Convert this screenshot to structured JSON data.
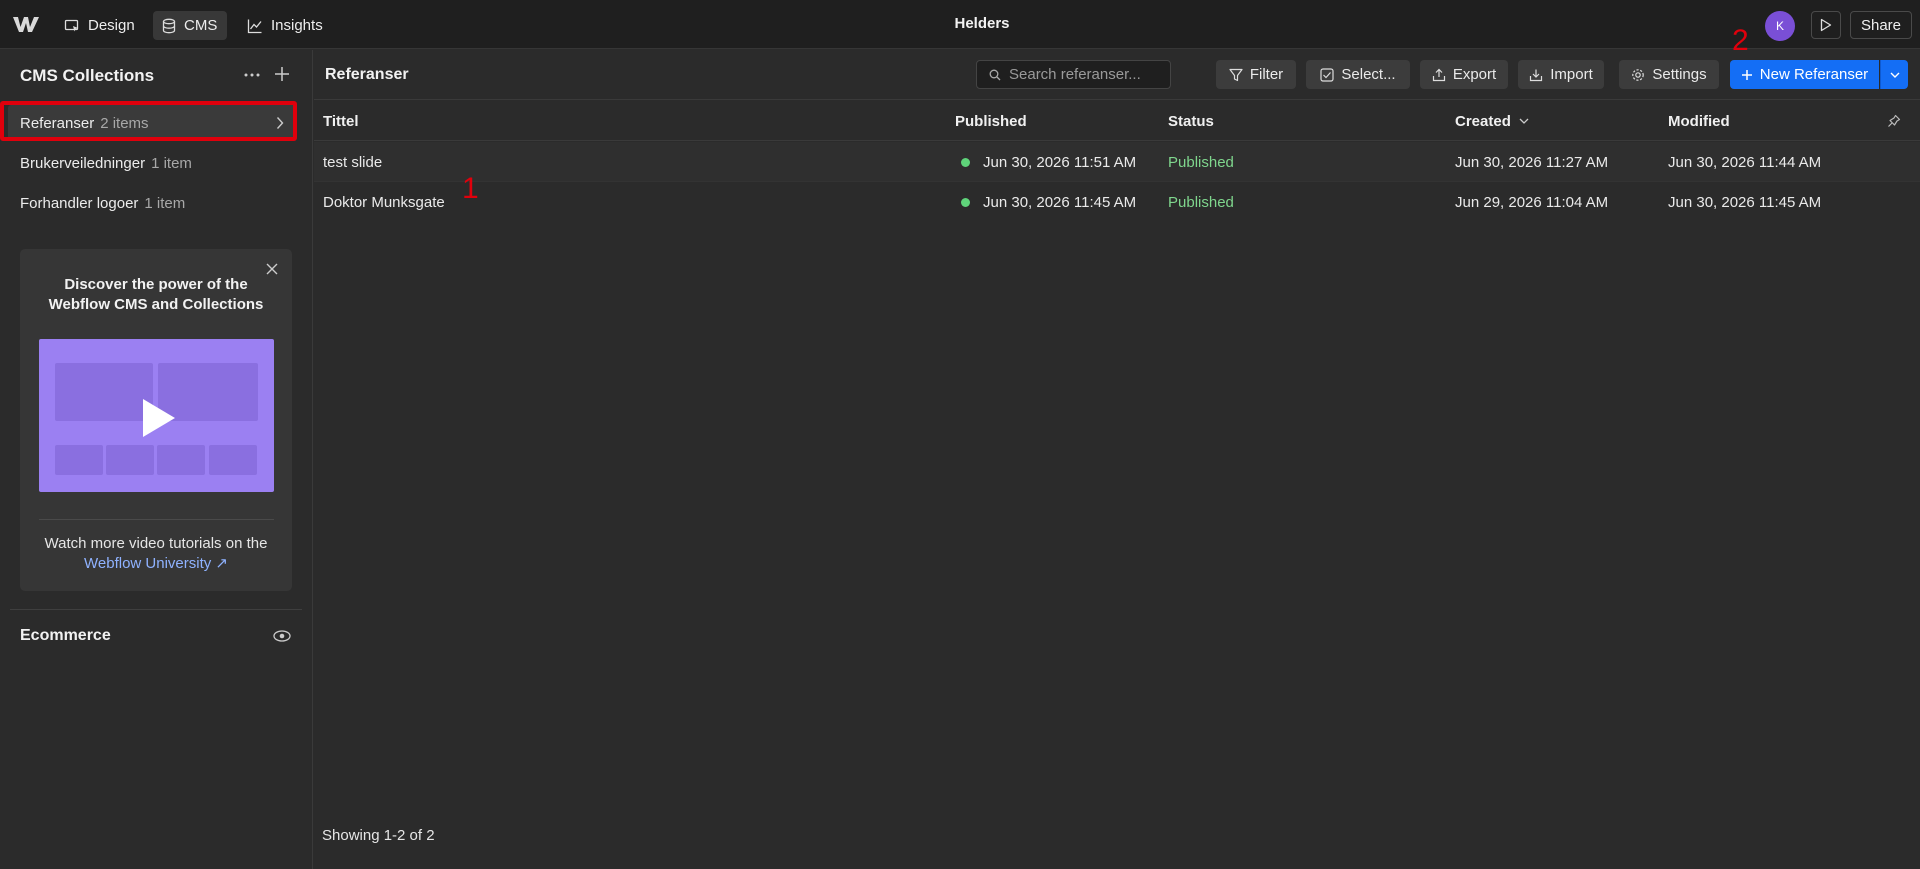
{
  "topbar": {
    "tabs": [
      {
        "label": "Design",
        "icon": "design-cursor-icon"
      },
      {
        "label": "CMS",
        "icon": "database-icon"
      },
      {
        "label": "Insights",
        "icon": "chart-line-icon"
      }
    ],
    "site_title": "Helders",
    "avatar_initial": "K",
    "share_label": "Share"
  },
  "sidebar": {
    "title": "CMS Collections",
    "collections": [
      {
        "name": "Referanser",
        "count": "2 items"
      },
      {
        "name": "Brukerveiledninger",
        "count": "1 item"
      },
      {
        "name": "Forhandler logoer",
        "count": "1 item"
      }
    ],
    "promo": {
      "title": "Discover the power of the Webflow CMS and Collections",
      "text": "Watch more video tutorials on the",
      "link": "Webflow University ↗"
    },
    "ecommerce_label": "Ecommerce"
  },
  "main": {
    "title": "Referanser",
    "search_placeholder": "Search referanser...",
    "toolbar": {
      "filter": "Filter",
      "select": "Select...",
      "export": "Export",
      "import": "Import",
      "settings": "Settings",
      "new": "New Referanser"
    },
    "columns": {
      "title": "Tittel",
      "published": "Published",
      "status": "Status",
      "created": "Created",
      "modified": "Modified"
    },
    "rows": [
      {
        "title": "test slide",
        "published": "Jun 30, 2026 11:51 AM",
        "status": "Published",
        "created": "Jun 30, 2026 11:27 AM",
        "modified": "Jun 30, 2026 11:44 AM"
      },
      {
        "title": "Doktor Munksgate",
        "published": "Jun 30, 2026 11:45 AM",
        "status": "Published",
        "created": "Jun 29, 2026 11:04 AM",
        "modified": "Jun 30, 2026 11:45 AM"
      }
    ],
    "footer": "Showing 1-2 of 2"
  },
  "annotations": [
    "1",
    "2"
  ],
  "colors": {
    "accent": "#146ef5",
    "status_published": "#7fd68d",
    "annotation_red": "#e0000c",
    "avatar": "#7a4fd6"
  }
}
